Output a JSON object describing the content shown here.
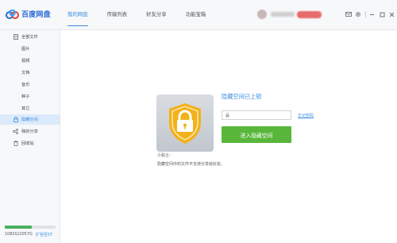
{
  "app": {
    "name": "百度网盘"
  },
  "nav": {
    "tabs": [
      {
        "label": "我的网盘"
      },
      {
        "label": "传输列表"
      },
      {
        "label": "好友分享"
      },
      {
        "label": "功能宝箱"
      }
    ]
  },
  "sidebar": {
    "items": [
      {
        "label": "全部文件",
        "icon": "file-icon"
      },
      {
        "label": "图片"
      },
      {
        "label": "视频"
      },
      {
        "label": "文档"
      },
      {
        "label": "音乐"
      },
      {
        "label": "种子"
      },
      {
        "label": "其它"
      },
      {
        "label": "隐藏空间",
        "icon": "lock-icon"
      },
      {
        "label": "我的分享",
        "icon": "share-icon"
      },
      {
        "label": "回收站",
        "icon": "trash-icon"
      }
    ]
  },
  "storage": {
    "used_text": "1082G/2057G",
    "expand_label": "扩容至5T",
    "used_fraction": 0.526
  },
  "main": {
    "locked_title": "隐藏空间已上锁",
    "password_placeholder": "",
    "forgot_link": "忘记密码",
    "enter_button": "进入隐藏空间",
    "tip_title": "小贴士:",
    "tip_text": "隐藏空间中的文件不支持分享给好友。"
  },
  "colors": {
    "accent": "#3b8be0",
    "button_green": "#58b73b",
    "lock_gold": "#f2b21b",
    "storage_bar": "#4cb05f"
  }
}
